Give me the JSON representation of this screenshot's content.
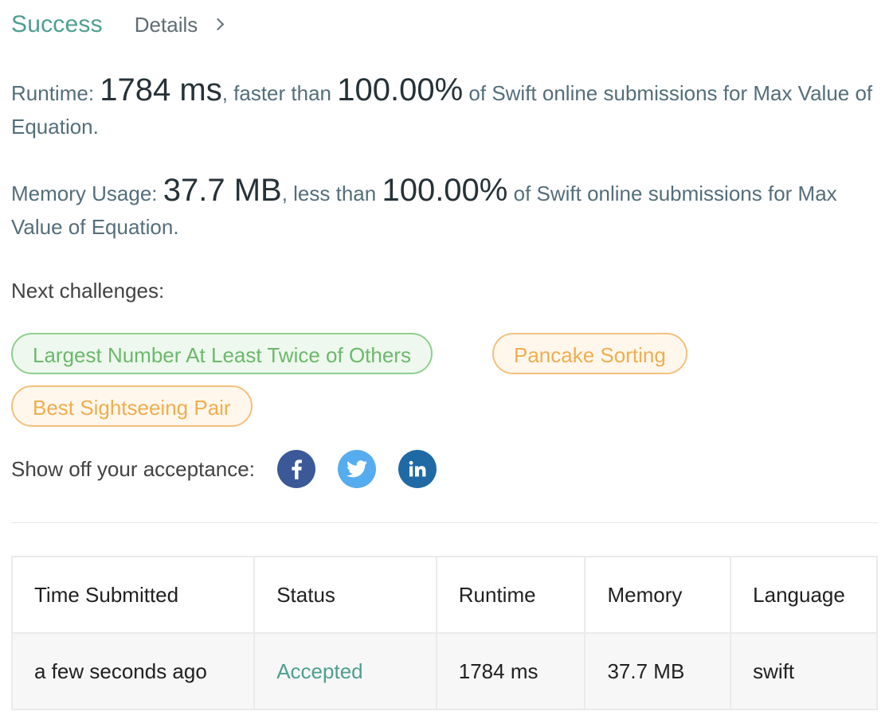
{
  "header": {
    "status": "Success",
    "details_label": "Details"
  },
  "runtime_stat": {
    "label": "Runtime:",
    "value": "1784 ms",
    "comparator": ", faster than",
    "percent": "100.00%",
    "suffix": "of Swift online submissions for Max Value of Equation."
  },
  "memory_stat": {
    "label": "Memory Usage:",
    "value": "37.7 MB",
    "comparator": ", less than",
    "percent": "100.00%",
    "suffix": "of Swift online submissions for Max Value of Equation."
  },
  "next_challenges": {
    "label": "Next challenges:",
    "items": [
      {
        "title": "Largest Number At Least Twice of Others",
        "difficulty_color": "#6cb86c"
      },
      {
        "title": "Pancake Sorting",
        "difficulty_color": "#f0ad4e"
      },
      {
        "title": "Best Sightseeing Pair",
        "difficulty_color": "#f0ad4e"
      }
    ]
  },
  "share": {
    "label": "Show off your acceptance:",
    "icons": [
      "facebook-icon",
      "twitter-icon",
      "linkedin-icon"
    ],
    "colors": {
      "facebook": "#3b5998",
      "twitter": "#55acee",
      "linkedin": "#1f6aa5"
    }
  },
  "submissions_table": {
    "columns": [
      "Time Submitted",
      "Status",
      "Runtime",
      "Memory",
      "Language"
    ],
    "rows": [
      {
        "time": "a few seconds ago",
        "status": "Accepted",
        "runtime": "1784 ms",
        "memory": "37.7 MB",
        "language": "swift"
      }
    ]
  },
  "colors": {
    "accent": "#4e9f8f",
    "easy": "#6cb86c",
    "medium": "#f0ad4e"
  }
}
